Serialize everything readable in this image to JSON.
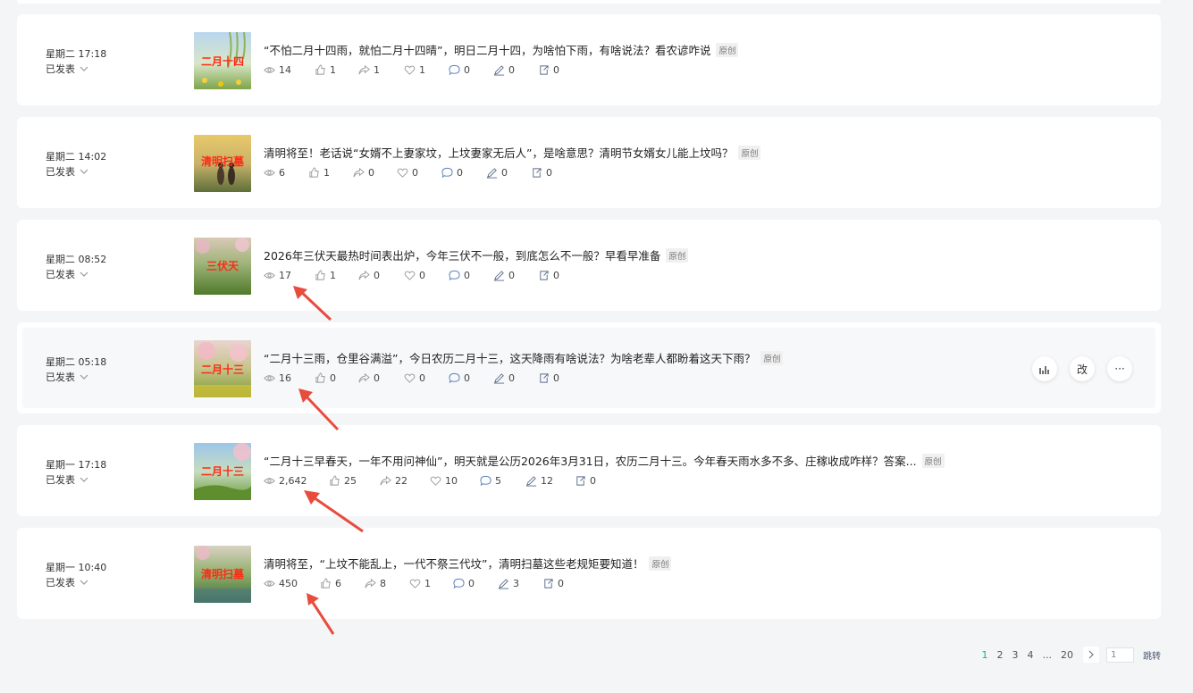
{
  "icons": {
    "views": "eye-icon",
    "likes": "thumbs-up-icon",
    "shares": "share-arrow-icon",
    "favorites": "heart-icon",
    "comments": "comment-icon",
    "notes": "pen-icon",
    "follows": "follow-icon"
  },
  "colors": {
    "active_page": "#07c160",
    "annotation_arrow": "#e84c3d",
    "thumb_text": "#ff2a14"
  },
  "articles": [
    {
      "date": "星期二 17:18",
      "status": "已发表",
      "thumb_text": "二月十四",
      "title": "“不怕二月十四雨，就怕二月十四晴”，明日二月十四，为啥怕下雨，有啥说法？看农谚咋说",
      "badge": "原创",
      "stats": {
        "views": "14",
        "likes": "1",
        "shares": "1",
        "favorites": "1",
        "comments": "0",
        "notes": "0",
        "follows": "0"
      }
    },
    {
      "date": "星期二 14:02",
      "status": "已发表",
      "thumb_text": "清明扫墓",
      "title": "清明将至！老话说“女婿不上妻家坟，上坟妻家无后人”，是啥意思？清明节女婿女儿能上坟吗？",
      "badge": "原创",
      "stats": {
        "views": "6",
        "likes": "1",
        "shares": "0",
        "favorites": "0",
        "comments": "0",
        "notes": "0",
        "follows": "0"
      }
    },
    {
      "date": "星期二 08:52",
      "status": "已发表",
      "thumb_text": "三伏天",
      "title": "2026年三伏天最热时间表出炉，今年三伏不一般，到底怎么不一般？早看早准备",
      "badge": "原创",
      "stats": {
        "views": "17",
        "likes": "1",
        "shares": "0",
        "favorites": "0",
        "comments": "0",
        "notes": "0",
        "follows": "0"
      }
    },
    {
      "date": "星期二 05:18",
      "status": "已发表",
      "thumb_text": "二月十三",
      "title": "“二月十三雨，仓里谷满溢”，今日农历二月十三，这天降雨有啥说法？为啥老辈人都盼着这天下雨？",
      "badge": "原创",
      "stats": {
        "views": "16",
        "likes": "0",
        "shares": "0",
        "favorites": "0",
        "comments": "0",
        "notes": "0",
        "follows": "0"
      },
      "actions": {
        "stats_icon": "bar-chart-icon",
        "edit": "改",
        "more": "···"
      }
    },
    {
      "date": "星期一 17:18",
      "status": "已发表",
      "thumb_text": "二月十三",
      "title": "“二月十三早春天，一年不用问神仙”，明天就是公历2026年3月31日，农历二月十三。今年春天雨水多不多、庄稼收成咋样？答案...",
      "badge": "原创",
      "stats": {
        "views": "2,642",
        "likes": "25",
        "shares": "22",
        "favorites": "10",
        "comments": "5",
        "notes": "12",
        "follows": "0"
      }
    },
    {
      "date": "星期一 10:40",
      "status": "已发表",
      "thumb_text": "清明扫墓",
      "title": "清明将至，“上坟不能乱上，一代不祭三代坟”，清明扫墓这些老规矩要知道！",
      "badge": "原创",
      "stats": {
        "views": "450",
        "likes": "6",
        "shares": "8",
        "favorites": "1",
        "comments": "0",
        "notes": "3",
        "follows": "0"
      }
    }
  ],
  "pagination": {
    "pages": [
      "1",
      "2",
      "3",
      "4",
      "...",
      "20"
    ],
    "input_value": "1",
    "jump_label": "跳转"
  }
}
